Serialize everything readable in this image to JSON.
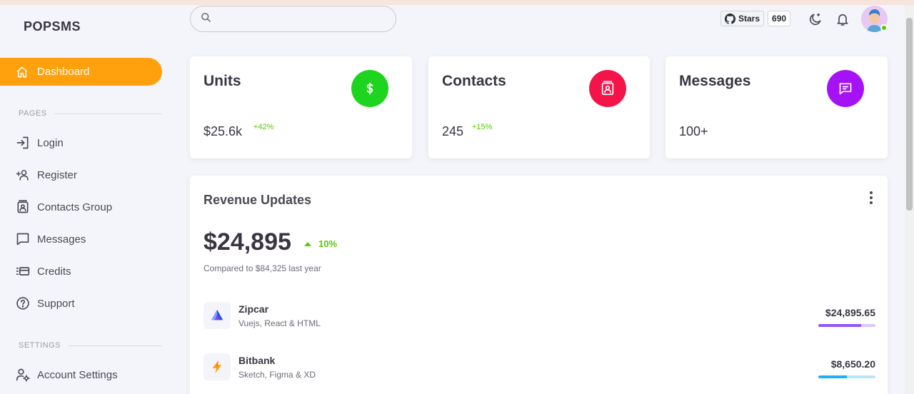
{
  "brand": "POPSMS",
  "sidebar": {
    "active_item": "Dashboard",
    "pages_label": "PAGES",
    "items": [
      {
        "label": "Login",
        "icon": "login-icon"
      },
      {
        "label": "Register",
        "icon": "add-user-icon"
      },
      {
        "label": "Contacts Group",
        "icon": "contacts-icon"
      },
      {
        "label": "Messages",
        "icon": "message-icon"
      },
      {
        "label": "Credits",
        "icon": "credit-card-icon"
      },
      {
        "label": "Support",
        "icon": "help-icon"
      }
    ],
    "settings_label": "SETTINGS",
    "settings_items": [
      {
        "label": "Account Settings",
        "icon": "user-settings-icon"
      }
    ]
  },
  "search": {
    "placeholder": ""
  },
  "github": {
    "label": "Stars",
    "count": "690"
  },
  "stats": [
    {
      "title": "Units",
      "value": "$25.6k",
      "change": "+42%",
      "icon": "dollar-icon",
      "color": "#1ed41e"
    },
    {
      "title": "Contacts",
      "value": "245",
      "change": "+15%",
      "icon": "contact-card-icon",
      "color": "#f5144a"
    },
    {
      "title": "Messages",
      "value": "100+",
      "change": "",
      "icon": "chat-icon",
      "color": "#a512f5"
    }
  ],
  "revenue": {
    "title": "Revenue Updates",
    "amount": "$24,895",
    "trend": "10%",
    "compare": "Compared to $84,325 last year",
    "rows": [
      {
        "name": "Zipcar",
        "sub": "Vuejs, React & HTML",
        "amount": "$24,895.65",
        "progress": 0.75,
        "bar_color": "#9155fd",
        "bar_bg": "#dcc8fb"
      },
      {
        "name": "Bitbank",
        "sub": "Sketch, Figma & XD",
        "amount": "$8,650.20",
        "progress": 0.5,
        "bar_color": "#16b1ff",
        "bar_bg": "#b8e5fb"
      }
    ]
  }
}
